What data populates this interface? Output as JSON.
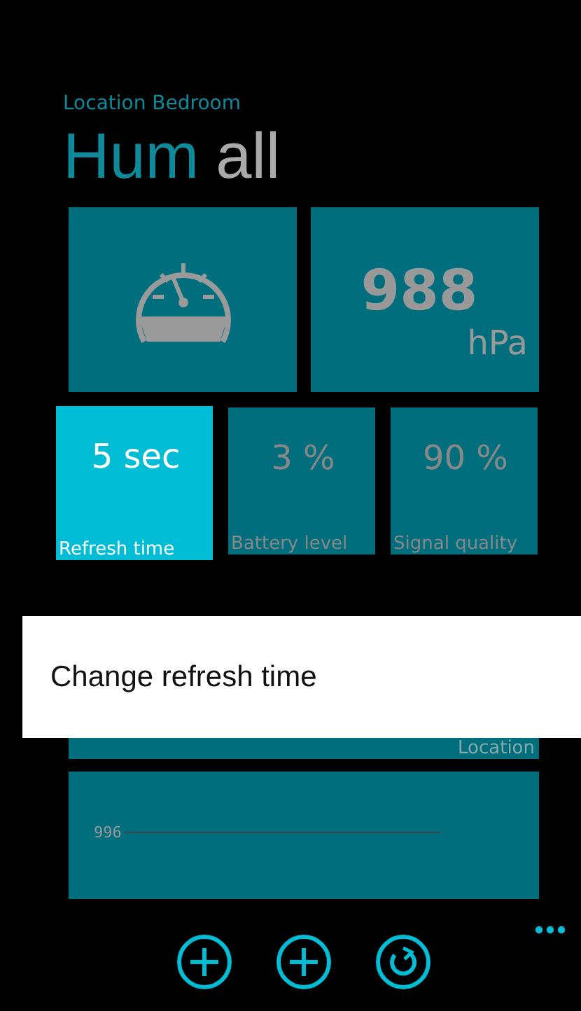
{
  "header": {
    "subtitle": "Location Bedroom",
    "title_active": "Hum",
    "title_rest": "all"
  },
  "big_tiles": [
    {
      "kind": "gauge"
    },
    {
      "kind": "value",
      "value": "988",
      "unit": "hPa"
    }
  ],
  "small_tiles": [
    {
      "value": "5 sec",
      "label": "Refresh time",
      "selected": true
    },
    {
      "value": "3 %",
      "label": "Battery level",
      "selected": false
    },
    {
      "value": "90 %",
      "label": "Signal quality",
      "selected": false
    }
  ],
  "context_menu": {
    "items": [
      "Change refresh time"
    ]
  },
  "location_tile": {
    "label": "Location"
  },
  "chart_tile": {
    "tick_label": "996"
  },
  "app_bar": {
    "buttons": [
      {
        "kind": "add"
      },
      {
        "kind": "add"
      },
      {
        "kind": "refresh"
      }
    ]
  }
}
